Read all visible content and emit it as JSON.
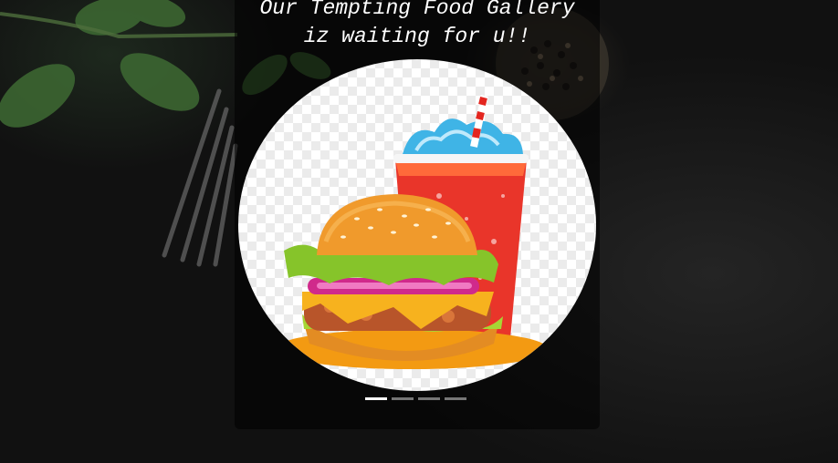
{
  "gallery": {
    "heading_line1": "Our Tempting Food Gallery",
    "heading_line2": "iz waiting for u!!",
    "slides": [
      {
        "subject": "burger-and-soda"
      },
      {
        "subject": "slide-2"
      },
      {
        "subject": "slide-3"
      },
      {
        "subject": "slide-4"
      }
    ],
    "active_slide": 1,
    "slide_count": 4
  },
  "colors": {
    "background": "#121212",
    "overlay": "rgba(0,0,0,0.55)",
    "heading": "#ffffff",
    "indicator_active": "#ffffff",
    "indicator_inactive": "rgba(255,255,255,0.45)"
  }
}
